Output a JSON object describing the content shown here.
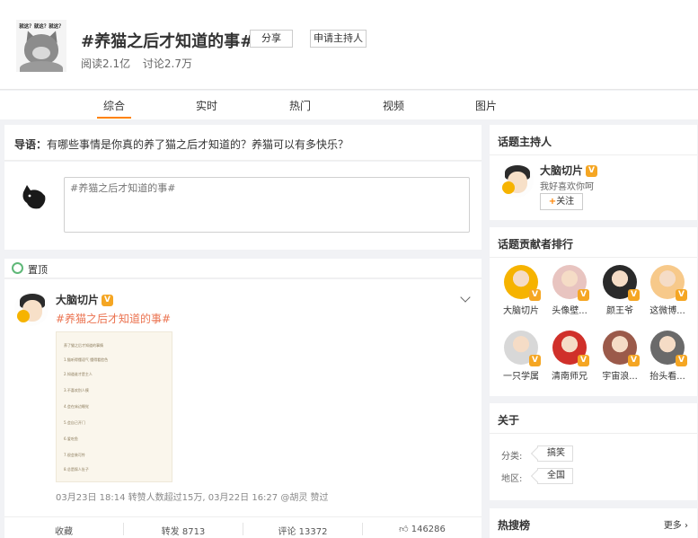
{
  "header": {
    "cover_caption": "就这？就这？就这？",
    "title": "#养猫之后才知道的事#",
    "share_label": "分享",
    "apply_host_label": "申请主持人",
    "reads": "阅读2.1亿",
    "discussions": "讨论2.7万"
  },
  "tabs": [
    "综合",
    "实时",
    "热门",
    "视频",
    "图片"
  ],
  "intro": {
    "label": "导语：",
    "text": "有哪些事情是你真的养了猫之后才知道的？养猫可以有多快乐？"
  },
  "compose": {
    "placeholder": "#养猫之后才知道的事#"
  },
  "pinned": {
    "label": "置顶"
  },
  "post": {
    "author": "大脑切片",
    "verified": "V",
    "tag": "#养猫之后才知道的事#",
    "image_lines": [
      "养了猫之后才知道的事情",
      "1.猫听得懂语气 懂得看脸色",
      "2.知道谁才是主人",
      "3.不喜欢别人摸",
      "4.会在床边睡觉",
      "5.会自己开门",
      "6.爱吃鱼",
      "7.很会装可怜",
      "8.总是踩人肚子"
    ],
    "meta": "03月23日 18:14 转赞人数超过15万, 03月22日 16:27 @胡灵 赞过"
  },
  "actions": {
    "collect": "收藏",
    "repost": "转发 8713",
    "comment": "评论 13372",
    "like": "146286"
  },
  "host_panel": {
    "title": "话题主持人",
    "name": "大脑切片",
    "desc": "我好喜欢你呵",
    "follow": "关注"
  },
  "contrib_panel": {
    "title": "话题贡献者排行",
    "items": [
      {
        "name": "大脑切片",
        "color": "#f6b300"
      },
      {
        "name": "头像壁...",
        "color": "#e8c4c0"
      },
      {
        "name": "颜王爷",
        "color": "#2a2a2a"
      },
      {
        "name": "这微博...",
        "color": "#f7c98a"
      },
      {
        "name": "一只学属",
        "color": "#d8d8d8"
      },
      {
        "name": "清南师兄",
        "color": "#d0302a"
      },
      {
        "name": "宇宙浪...",
        "color": "#9b5a4a"
      },
      {
        "name": "抬头看...",
        "color": "#6a6a6a"
      }
    ]
  },
  "about_panel": {
    "title": "关于",
    "category_label": "分类:",
    "category_value": "搞笑",
    "region_label": "地区:",
    "region_value": "全国"
  },
  "hot_panel": {
    "title": "热搜榜",
    "more": "更多 ›"
  }
}
